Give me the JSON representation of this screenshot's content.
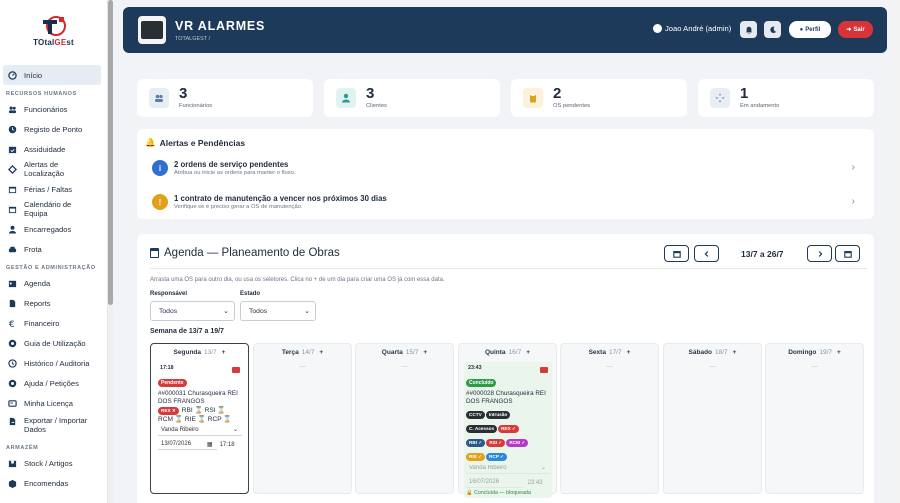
{
  "brand": {
    "logo_text_a": "TOtal",
    "logo_text_b": "GE",
    "logo_text_c": "st"
  },
  "sidebar": {
    "sections": [
      {
        "title": "",
        "items": [
          {
            "label": "Início",
            "icon": "gauge-icon",
            "active": true
          }
        ]
      },
      {
        "title": "RECURSOS HUMANOS",
        "items": [
          {
            "label": "Funcionários",
            "icon": "users-icon"
          },
          {
            "label": "Registo de Ponto",
            "icon": "clock-icon"
          },
          {
            "label": "Assiduidade",
            "icon": "calendar-check-icon"
          },
          {
            "label": "Alertas de Localização",
            "icon": "location-icon"
          },
          {
            "label": "Férias / Faltas",
            "icon": "calendar-icon"
          },
          {
            "label": "Calendário de Equipa",
            "icon": "calendar-icon"
          },
          {
            "label": "Encarregados",
            "icon": "user-icon"
          },
          {
            "label": "Frota",
            "icon": "car-icon"
          }
        ]
      },
      {
        "title": "GESTÃO E ADMINISTRAÇÃO",
        "items": [
          {
            "label": "Agenda",
            "icon": "agenda-icon"
          },
          {
            "label": "Reports",
            "icon": "file-icon"
          },
          {
            "label": "Financeiro",
            "icon": "euro-icon"
          },
          {
            "label": "Guia de Utilização",
            "icon": "help-icon"
          },
          {
            "label": "Histórico / Auditoria",
            "icon": "history-icon"
          },
          {
            "label": "Ajuda / Petições",
            "icon": "help-icon"
          },
          {
            "label": "Minha Licença",
            "icon": "license-icon"
          },
          {
            "label": "Exportar / Importar Dados",
            "icon": "export-icon"
          }
        ]
      },
      {
        "title": "ARMAZÉM",
        "items": [
          {
            "label": "Stock / Artigos",
            "icon": "box-icon"
          },
          {
            "label": "Encomendas",
            "icon": "orders-icon"
          }
        ]
      }
    ]
  },
  "header": {
    "title": "VR ALARMES",
    "breadcrumb": "TOTALGEST /",
    "user": "Joao André (admin)",
    "profile_label": "Perfil",
    "logout_label": "Sair"
  },
  "stats": [
    {
      "value": "3",
      "label": "Funcionários",
      "icon": "users-icon",
      "color": "#5b7ea6",
      "bg": "#e6edf5"
    },
    {
      "value": "3",
      "label": "Clientes",
      "icon": "user-icon",
      "color": "#2a9a92",
      "bg": "#e0f2f1"
    },
    {
      "value": "2",
      "label": "OS pendentes",
      "icon": "clipboard-icon",
      "color": "#d8a320",
      "bg": "#fbf2d9"
    },
    {
      "value": "1",
      "label": "Em andamento",
      "icon": "spinner-icon",
      "color": "#8aa2c0",
      "bg": "#eaeef4"
    }
  ],
  "alerts": {
    "title": "Alertas e Pendências",
    "items": [
      {
        "icon": "info-icon",
        "glyph": "i",
        "color": "#2e6fcf",
        "title": "2 ordens de serviço pendentes",
        "subtitle": "Atribua ou inicie as ordens para manter o fluxo."
      },
      {
        "icon": "warning-icon",
        "glyph": "!",
        "color": "#e0a21a",
        "title": "1 contrato de manutenção a vencer nos próximos 30 dias",
        "subtitle": "Verifique se é preciso gerar a OS de manutenção."
      }
    ]
  },
  "agenda": {
    "title": "Agenda — Planeamento de Obras",
    "range": "13/7 a 26/7",
    "hint": "Arrasta uma OS para outro dia, ou usa os seletores. Clica no + de um dia para criar uma OS já com essa data.",
    "responsavel_label": "Responsável",
    "responsavel_value": "Todos",
    "estado_label": "Estado",
    "estado_value": "Todos",
    "week_label": "Semana de 13/7 a 19/7",
    "days": [
      {
        "name": "Segunda",
        "date": "13/7",
        "plus": "+",
        "today": true,
        "empty": ""
      },
      {
        "name": "Terça",
        "date": "14/7",
        "plus": "+",
        "empty": "—"
      },
      {
        "name": "Quarta",
        "date": "15/7",
        "plus": "+",
        "empty": "—"
      },
      {
        "name": "Quinta",
        "date": "16/7",
        "plus": "+",
        "empty": ""
      },
      {
        "name": "Sexta",
        "date": "17/7",
        "plus": "+",
        "empty": "—"
      },
      {
        "name": "Sábado",
        "date": "18/7",
        "plus": "+",
        "empty": "—"
      },
      {
        "name": "Domingo",
        "date": "19/7",
        "plus": "+",
        "empty": "—"
      }
    ],
    "card1": {
      "time": "17:18",
      "status": "Pendente",
      "status_color": "#d63b3b",
      "title": "##000031 Churasqueira REI DOS FRANGOS",
      "tag": "REX ✕",
      "services_a": "RBI ⌛ RSI ⌛",
      "services_b": "RCM ⌛ RIE ⌛ RCP ⌛",
      "assignee": "Vanda Ribeiro",
      "date": "13/07/2026",
      "hour": "17:18"
    },
    "card2": {
      "time": "23:43",
      "status": "Concluído",
      "status_color": "#2f9a48",
      "title": "##000028 Churasqueira REI DOS FRANGOS",
      "tags_row1": [
        "CCTV",
        "Intrusão"
      ],
      "tags_row2": [
        "C. Acessos",
        "REX ✓"
      ],
      "tags_row3": [
        "RBI ✓",
        "RSI ✓",
        "RCM ✓"
      ],
      "tags_row4": [
        "RIE ✓",
        "RCP ✓"
      ],
      "assignee": "Vanda Ribeiro",
      "date": "16/07/2026",
      "hour": "23:43",
      "locked": "🔒 Concluída — bloqueada"
    }
  }
}
